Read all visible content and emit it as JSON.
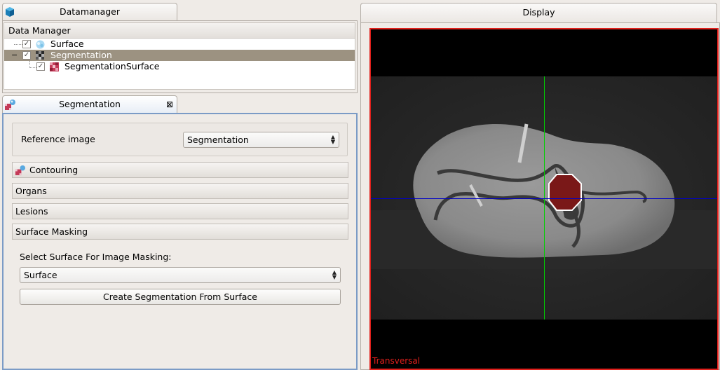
{
  "datamanager": {
    "tab_title": "Datamanager",
    "header": "Data Manager",
    "nodes": [
      {
        "label": "Surface",
        "checked": true,
        "selected": false
      },
      {
        "label": "Segmentation",
        "checked": true,
        "selected": true,
        "expander": "−"
      },
      {
        "label": "SegmentationSurface",
        "checked": true,
        "selected": false
      }
    ]
  },
  "segmentation": {
    "tab_title": "Segmentation",
    "close_glyph": "⊠",
    "reference_image_label": "Reference image",
    "reference_image_value": "Segmentation",
    "sections": [
      "Contouring",
      "Organs",
      "Lesions",
      "Surface Masking"
    ],
    "mask_label": "Select Surface For Image Masking:",
    "mask_surface_value": "Surface",
    "create_button": "Create Segmentation From Surface"
  },
  "display": {
    "tab_title": "Display",
    "view_label": "Transversal"
  },
  "colors": {
    "selection": "#9c9281",
    "view_border": "#e0201c",
    "crosshair_vertical": "#00d000",
    "crosshair_horizontal": "#0000c8",
    "segmentation_fill": "#7a1818",
    "segmentation_outline": "#ffffff"
  },
  "icons": {
    "datamanager": "cube-icon",
    "segmentation": "segmentation-icon",
    "surface": "surface-icon",
    "segmentation_node": "image-icon",
    "segmentation_surface": "segmentation-surface-icon"
  }
}
